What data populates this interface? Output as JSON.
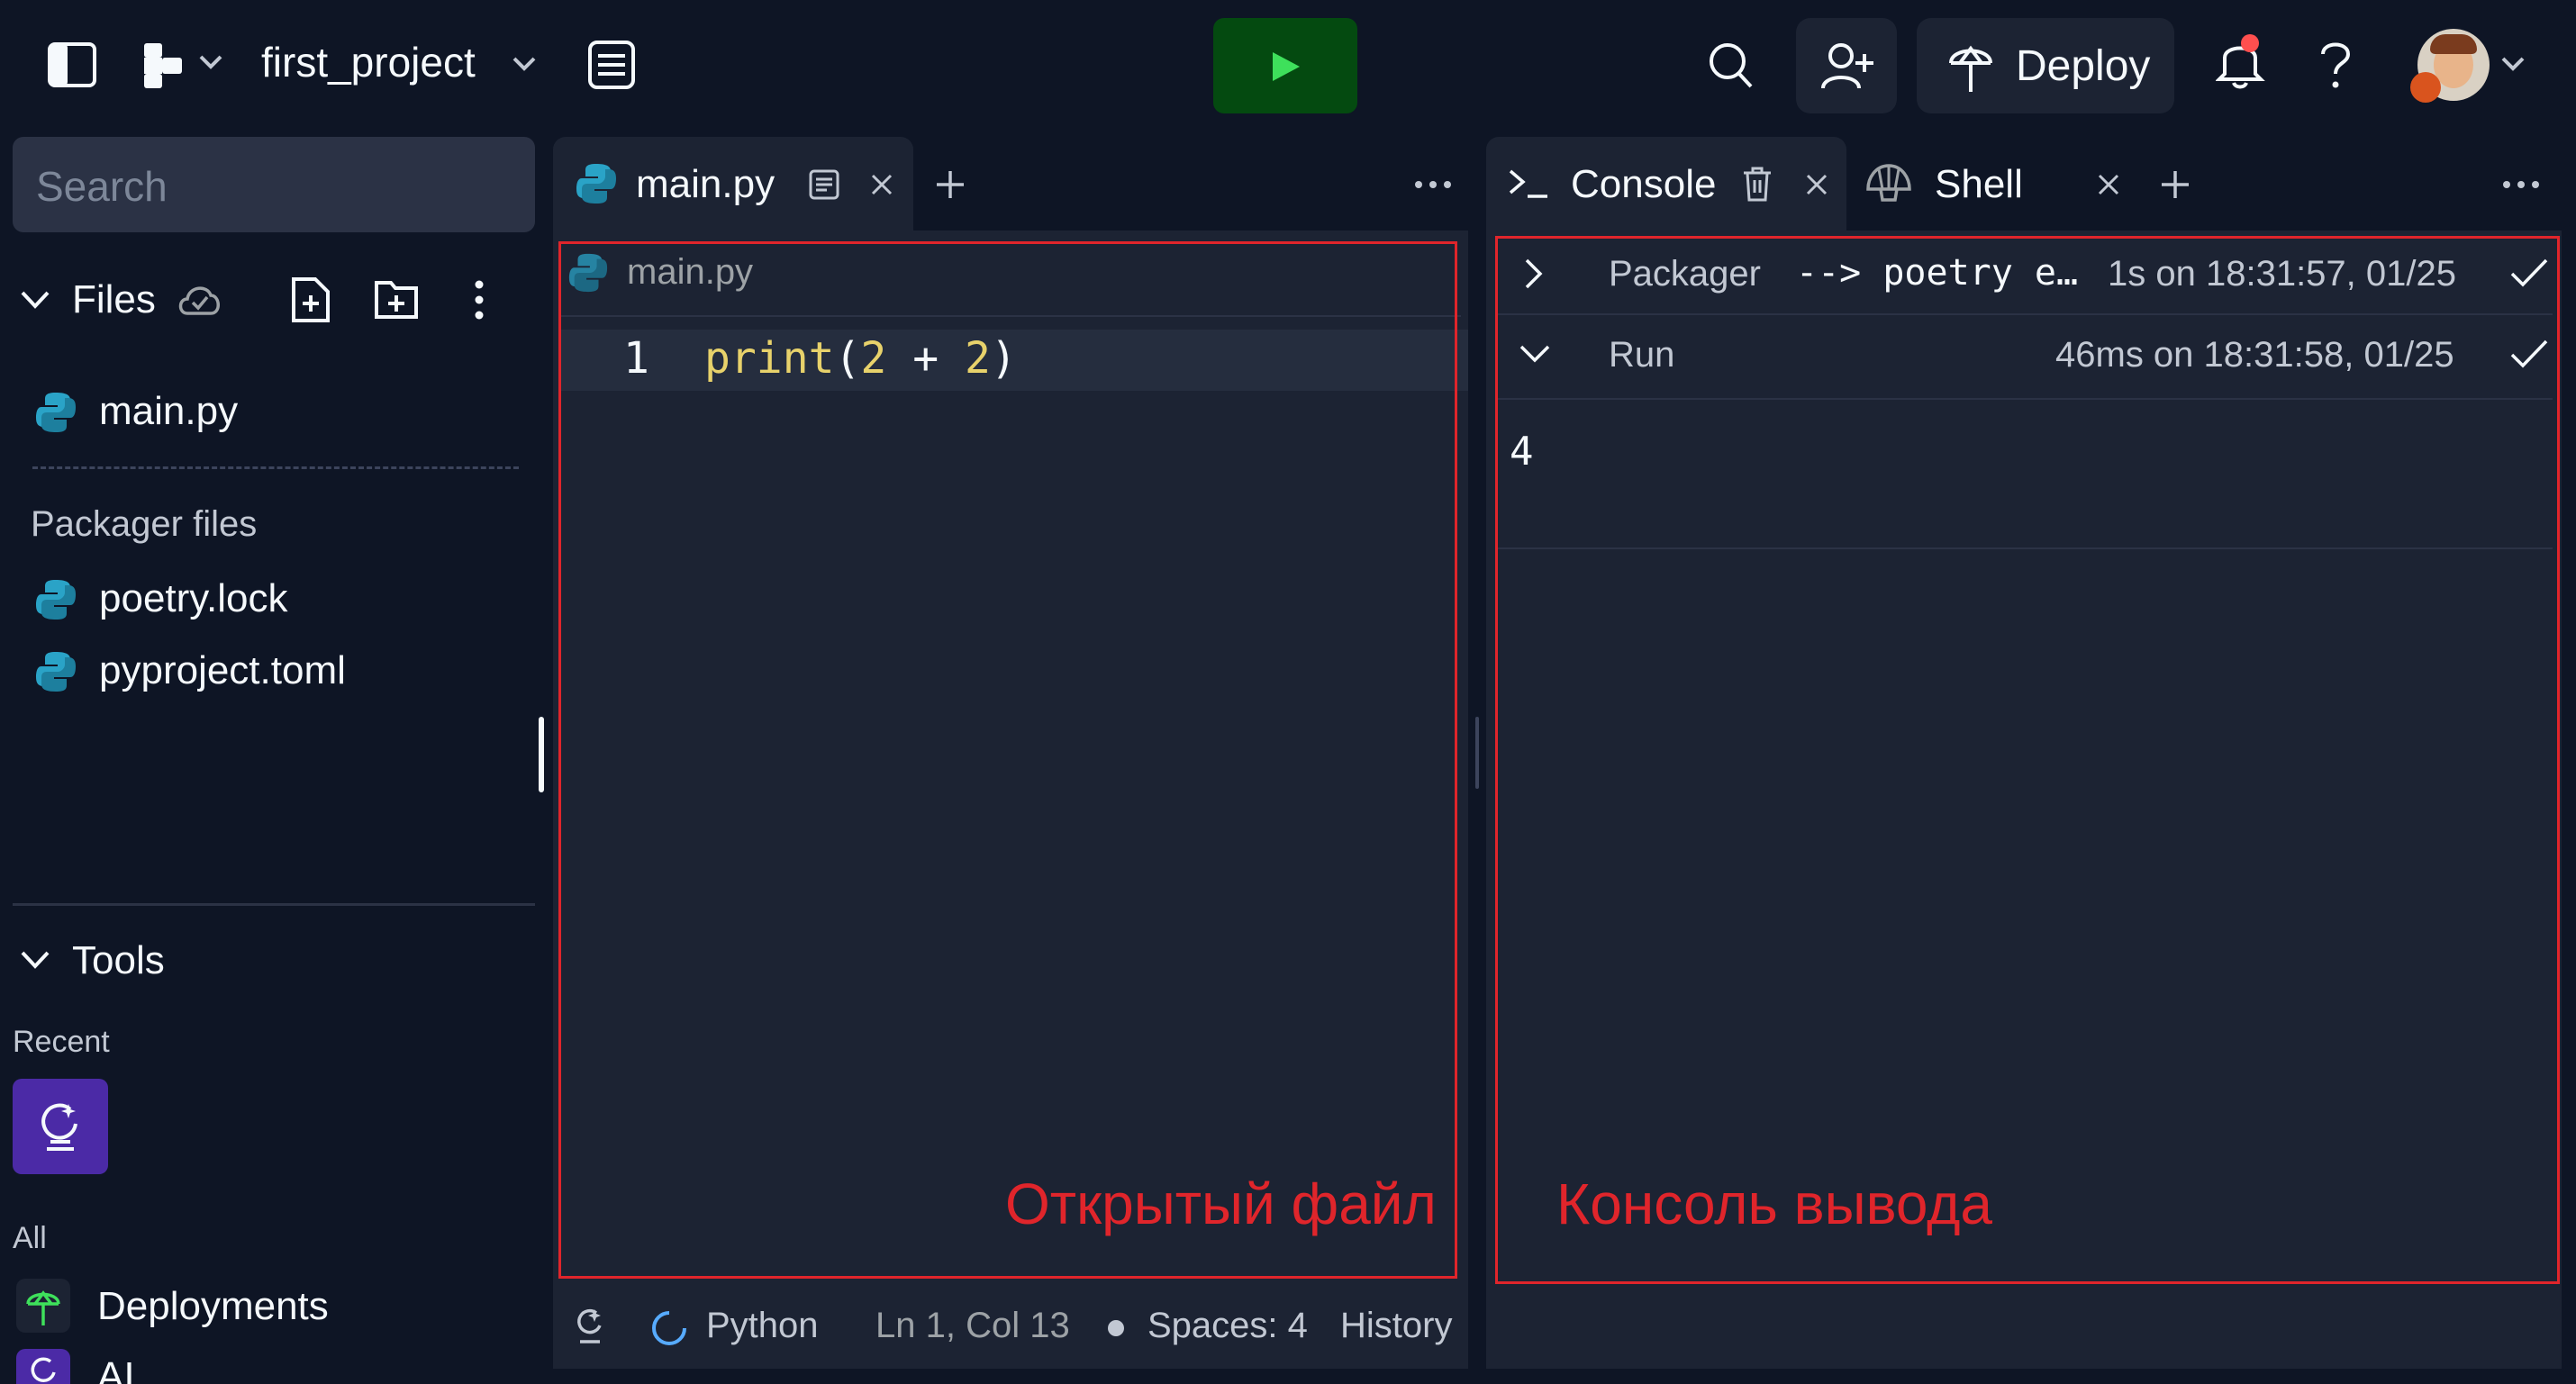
{
  "header": {
    "project_name": "first_project",
    "deploy_label": "Deploy",
    "colors": {
      "run_button": "#044a10",
      "run_icon": "#3ee05b",
      "notification_dot": "#ff4f4f"
    }
  },
  "sidebar": {
    "search_placeholder": "Search",
    "files_label": "Files",
    "files": [
      {
        "name": "main.py",
        "icon": "python-icon"
      }
    ],
    "packager_label": "Packager files",
    "packager_files": [
      {
        "name": "poetry.lock",
        "icon": "python-icon"
      },
      {
        "name": "pyproject.toml",
        "icon": "python-icon"
      }
    ],
    "tools_label": "Tools",
    "recent_label": "Recent",
    "all_label": "All",
    "tools": [
      {
        "name": "Deployments",
        "icon": "deployments-icon"
      },
      {
        "name": "AI",
        "icon": "ai-icon"
      }
    ]
  },
  "editor": {
    "tab_label": "main.py",
    "breadcrumb": "main.py",
    "lines": [
      {
        "number": "1",
        "code": {
          "fn": "print",
          "open": "(",
          "a": "2",
          "op": " + ",
          "b": "2",
          "close": ")"
        }
      }
    ],
    "status": {
      "language": "Python",
      "position": "Ln 1, Col 13",
      "spaces": "Spaces: 4",
      "history": "History"
    },
    "annotation": "Открытый файл"
  },
  "console": {
    "tab_console": "Console",
    "tab_shell": "Shell",
    "rows": [
      {
        "label": "Packager",
        "command": "--> poetry e…",
        "time": "1s on 18:31:57, 01/25"
      },
      {
        "label": "Run",
        "command": "",
        "time": "46ms on 18:31:58, 01/25"
      }
    ],
    "output": "4",
    "annotation": "Консоль вывода"
  }
}
